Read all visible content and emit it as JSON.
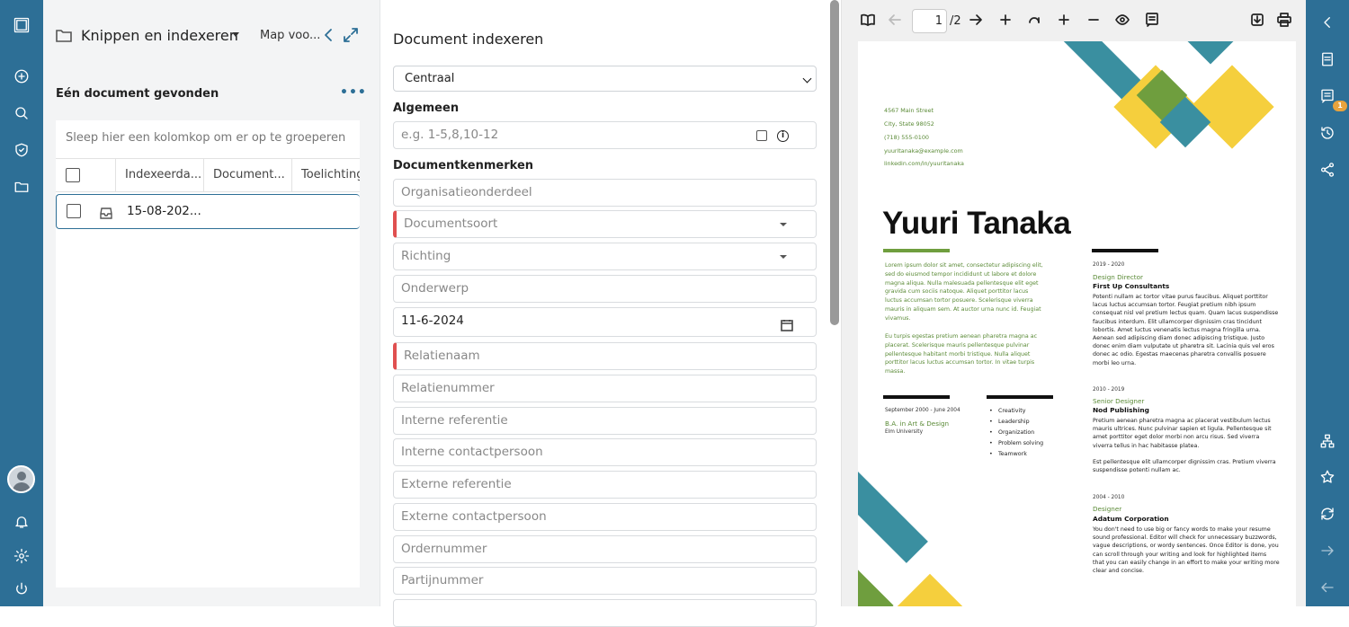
{
  "left_panel": {
    "title": "Knippen en indexeren",
    "map_label": "Map voo...",
    "found_text": "Eén document gevonden",
    "group_hint": "Sleep hier een kolomkop om er op te groeperen",
    "columns": [
      "Indexeerda...",
      "Document...",
      "Toelichting"
    ],
    "rows": [
      {
        "date": "15-08-202..."
      }
    ]
  },
  "form": {
    "title": "Document indexeren",
    "select_value": "Centraal",
    "section_general": "Algemeen",
    "pages_placeholder": "e.g. 1-5,8,10-12",
    "section_props": "Documentkenmerken",
    "fields": {
      "organisatie": "Organisatieonderdeel",
      "documentsoort": "Documentsoort",
      "richting": "Richting",
      "onderwerp": "Onderwerp",
      "datum": "11-6-2024",
      "relatienaam": "Relatienaam",
      "relatienummer": "Relatienummer",
      "interne_ref": "Interne referentie",
      "interne_contact": "Interne contactpersoon",
      "externe_ref": "Externe referentie",
      "externe_contact": "Externe contactpersoon",
      "ordernummer": "Ordernummer",
      "partijnummer": "Partijnummer"
    }
  },
  "viewer": {
    "page_current": "1",
    "page_total": "/2"
  },
  "resume": {
    "contact": [
      "4567 Main Street",
      "City, State 98052",
      "(718) 555-0100",
      "yuuritanaka@example.com",
      "linkedin.com/in/yuuritanaka"
    ],
    "name": "Yuuri Tanaka",
    "intro1": [
      "Lorem ipsum dolor sit amet, consectetur adipiscing elit,",
      "sed do eiusmod tempor incididunt ut labore et dolore",
      "magna aliqua. Nulla malesuada pellentesque elit eget",
      "gravida cum sociis natoque. Aliquet porttitor lacus",
      "luctus accumsan tortor posuere. Scelerisque viverra",
      "mauris in aliquam sem. At auctor urna nunc id. Feugiat",
      "vivamus."
    ],
    "intro2": [
      "Eu turpis egestas pretium aenean pharetra magna ac",
      "placerat. Scelerisque mauris pellentesque pulvinar",
      "pellentesque habitant morbi tristique. Nulla aliquet",
      "porttitor lacus luctus accumsan tortor. In vitae turpis",
      "massa."
    ],
    "edu_date": "September 2000 - June 2004",
    "edu_degree": "B.A. in Art & Design",
    "edu_school": "Elm University",
    "skills": [
      "Creativity",
      "Leadership",
      "Organization",
      "Problem solving",
      "Teamwork"
    ],
    "jobs": [
      {
        "date": "2019 - 2020",
        "role": "Design Director",
        "company": "First Up Consultants",
        "text": [
          "Potenti nullam ac tortor vitae purus faucibus. Aliquet porttitor",
          "lacus luctus accumsan tortor. Feugiat pretium nibh ipsum",
          "consequat nisl vel pretium lectus quam. Quam lacus suspendisse",
          "faucibus interdum. Elit ullamcorper dignissim cras tincidunt",
          "lobortis. Amet luctus venenatis lectus magna fringilla urna.",
          "Aenean sed adipiscing diam donec adipiscing tristique. Justo",
          "donec enim diam vulputate ut pharetra sit. Lacinia quis vel eros",
          "donec ac odio. Egestas maecenas pharetra convallis posuere",
          "morbi leo urna."
        ]
      },
      {
        "date": "2010 - 2019",
        "role": "Senior Designer",
        "company": "Nod Publishing",
        "text": [
          "Pretium aenean pharetra magna ac placerat vestibulum lectus",
          "mauris ultrices. Nunc pulvinar sapien et ligula. Pellentesque sit",
          "amet porttitor eget dolor morbi non arcu risus. Sed viverra",
          "viverra tellus in hac habitasse platea.",
          "",
          "Est pellentesque elit ullamcorper dignissim cras. Pretium viverra",
          "suspendisse potenti nullam ac."
        ]
      },
      {
        "date": "2004 - 2010",
        "role": "Designer",
        "company": "Adatum Corporation",
        "text": [
          "You don't need to use big or fancy words to make your resume",
          "sound professional. Editor will check for unnecessary buzzwords,",
          "vague descriptions, or wordy sentences. Once Editor is done, you",
          "can scroll through your writing and look for highlighted items",
          "that you can easily change in an effort to make your writing more",
          "clear and concise."
        ]
      }
    ]
  },
  "colors": {
    "nav": "#2d6f96",
    "teal": "#3a8fa0",
    "yellow": "#f5cf3d",
    "green": "#6f9e3e",
    "required": "#e05050",
    "badge": "#e8a33d"
  },
  "badge_count": "1"
}
